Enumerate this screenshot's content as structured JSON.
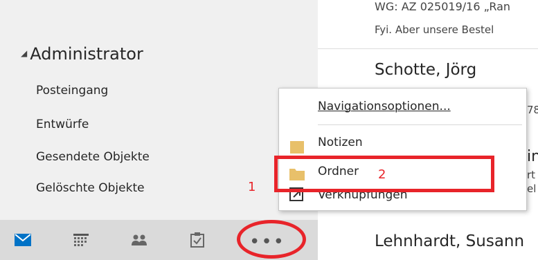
{
  "folder_pane": {
    "account": "Administrator",
    "folders": [
      "Posteingang",
      "Entwürfe",
      "Gesendete Objekte",
      "Gelöschte Objekte"
    ]
  },
  "nav_bar": {
    "icons": [
      "mail-icon",
      "calendar-icon",
      "people-icon",
      "tasks-icon",
      "more-icon"
    ],
    "more_label": "•••"
  },
  "mail_list": {
    "subject_top": "WG: AZ 025019/16 „Ran",
    "preview_top": "Fyi.  Aber unsere Bestel",
    "sender_1": "Schotte, Jörg",
    "sender_1_fragment": "78",
    "sender_2_fragments": [
      "in",
      "rt",
      "el"
    ],
    "sender_3": "Lehnhardt, Susann"
  },
  "popup_menu": {
    "items": [
      {
        "label": "Navigationsoptionen..."
      },
      {
        "label": "Notizen"
      },
      {
        "label": "Ordner"
      },
      {
        "label": "Verknüpfungen"
      }
    ]
  },
  "annotations": {
    "step_1": "1",
    "step_2": "2",
    "color": "#e8242a"
  },
  "colors": {
    "accent": "#0072c6",
    "folder": "#e8c06a"
  }
}
